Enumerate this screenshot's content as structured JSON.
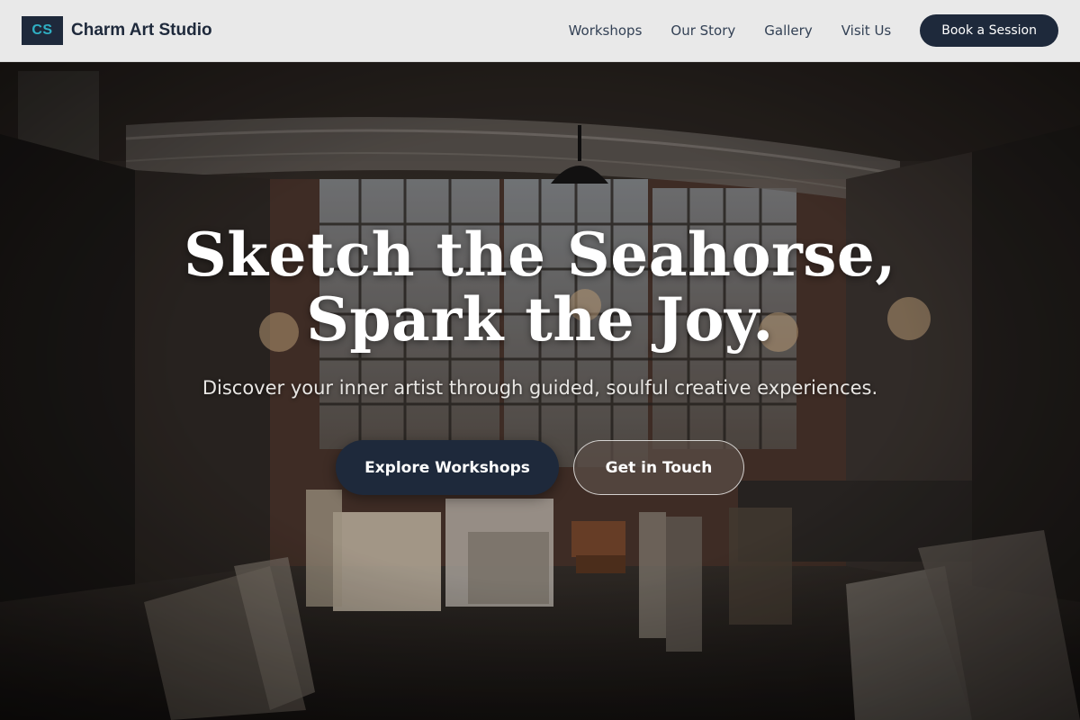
{
  "colors": {
    "primary": "#1e293b",
    "logo_accent": "#2fb0c4",
    "header_bg": "#e9e9e9",
    "text_light": "#ffffff"
  },
  "header": {
    "logo_mark": "CS",
    "brand_name": "Charm Art Studio",
    "nav": [
      {
        "label": "Workshops"
      },
      {
        "label": "Our Story"
      },
      {
        "label": "Gallery"
      },
      {
        "label": "Visit Us"
      }
    ],
    "cta_label": "Book a Session"
  },
  "hero": {
    "background_image": "art-studio-interior-photo",
    "headline_line1": "Sketch the Seahorse,",
    "headline_line2": "Spark the Joy.",
    "subheadline": "Discover your inner artist through guided, soulful creative experiences.",
    "primary_cta": "Explore Workshops",
    "secondary_cta": "Get in Touch"
  }
}
